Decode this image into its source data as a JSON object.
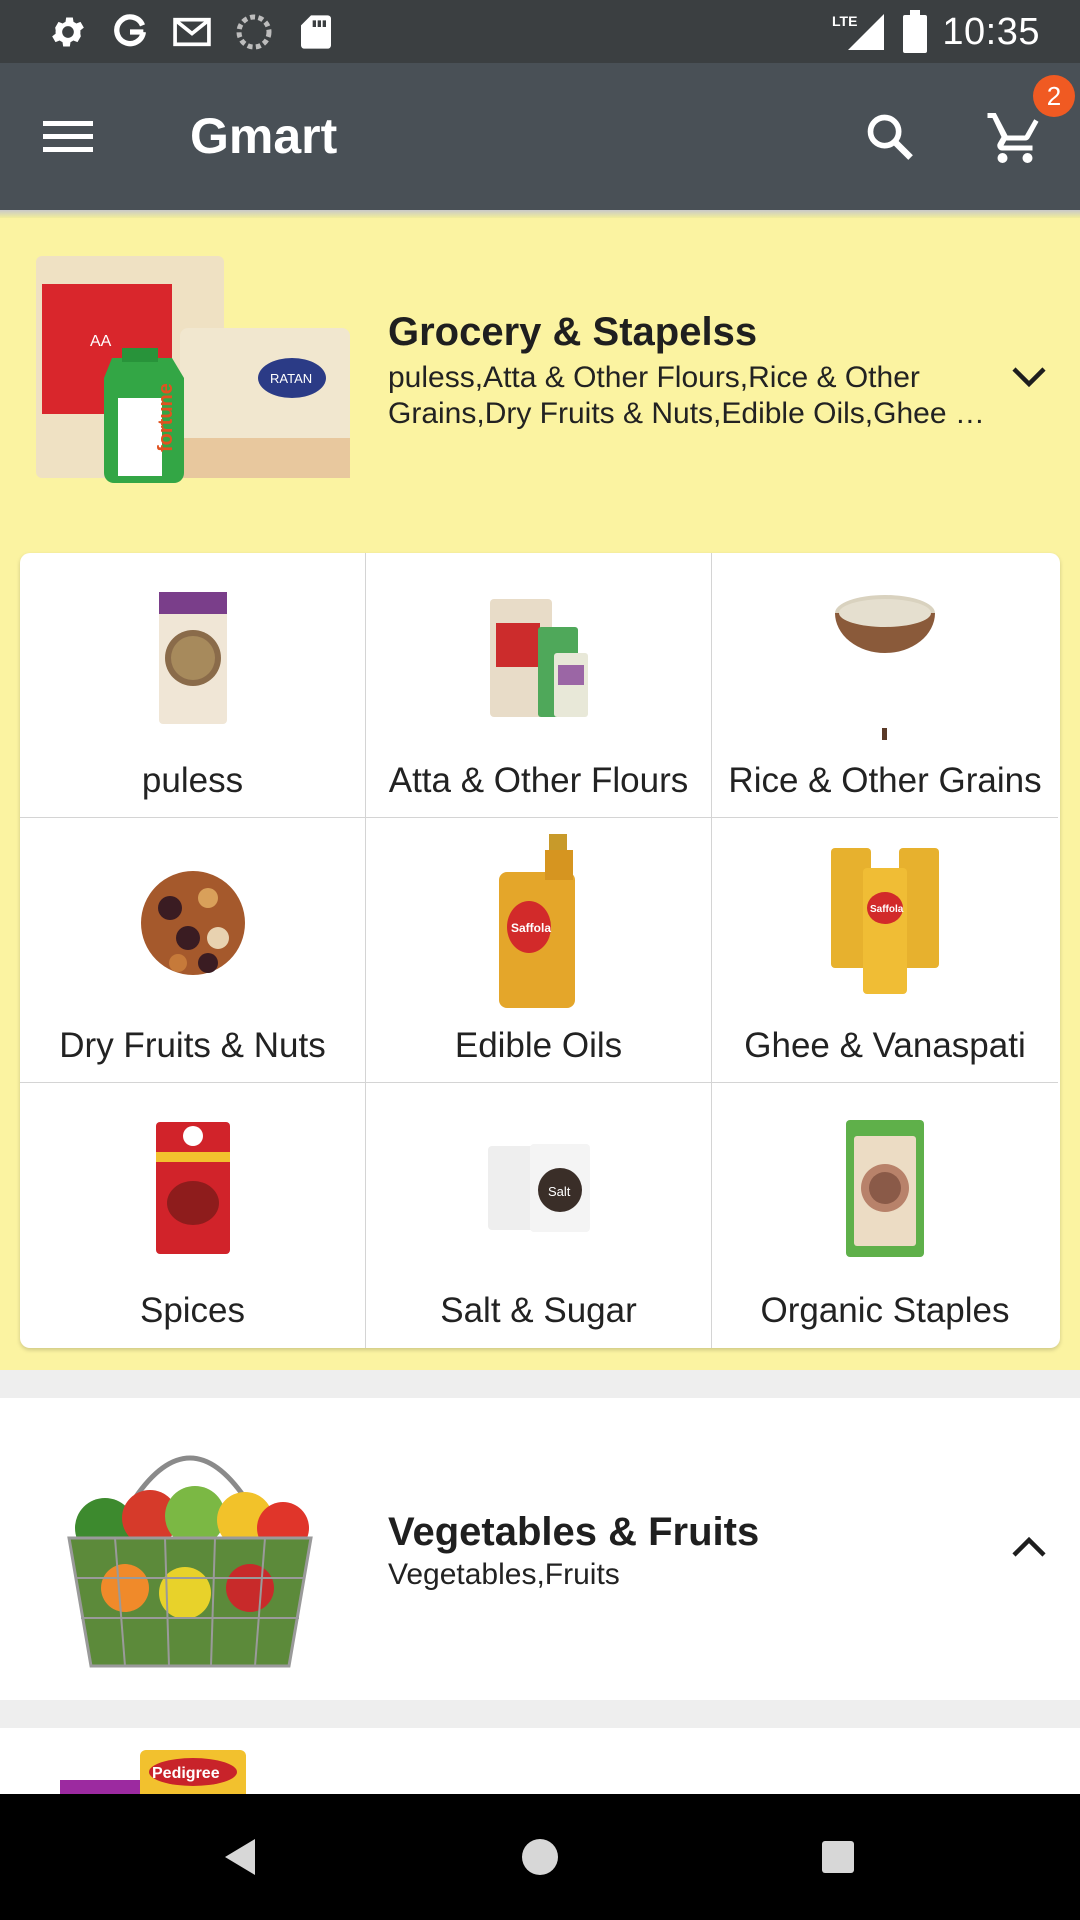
{
  "status_bar": {
    "time": "10:35",
    "network": "LTE",
    "icons": [
      "settings-icon",
      "google-icon",
      "gmail-icon",
      "sync-icon",
      "sd-card-icon",
      "lte-signal-icon",
      "battery-icon"
    ]
  },
  "app_bar": {
    "title": "Gmart",
    "cart_count": "2",
    "icons": [
      "menu-icon",
      "search-icon",
      "cart-icon"
    ]
  },
  "categories": [
    {
      "title": "Grocery & Stapelss",
      "subtitle": "puless,Atta & Other Flours,Rice & Other Grains,Dry Fruits & Nuts,Edible Oils,Ghee …",
      "expanded": true,
      "background": "#fbf3a1",
      "subcategories": [
        {
          "label": "puless"
        },
        {
          "label": "Atta & Other Flours"
        },
        {
          "label": "Rice & Other Grains"
        },
        {
          "label": "Dry Fruits & Nuts"
        },
        {
          "label": "Edible Oils"
        },
        {
          "label": "Ghee & Vanaspati"
        },
        {
          "label": "Spices"
        },
        {
          "label": "Salt & Sugar"
        },
        {
          "label": "Organic Staples"
        }
      ]
    },
    {
      "title": "Vegetables & Fruits",
      "subtitle": "Vegetables,Fruits",
      "expanded": false,
      "background": "#ffffff"
    }
  ],
  "product_text": {
    "atta_bag": "AA",
    "oil_brand": "fortune",
    "rice_brand": "RATAN",
    "oil_bottle": "Saffola",
    "ghee_pack": "Saffola",
    "salt_pack": "Salt",
    "pedigree": "Pedigree"
  },
  "colors": {
    "status_bar": "#3b3f41",
    "app_bar": "#495056",
    "badge": "#f05a22",
    "expanded_bg": "#fbf3a1"
  }
}
